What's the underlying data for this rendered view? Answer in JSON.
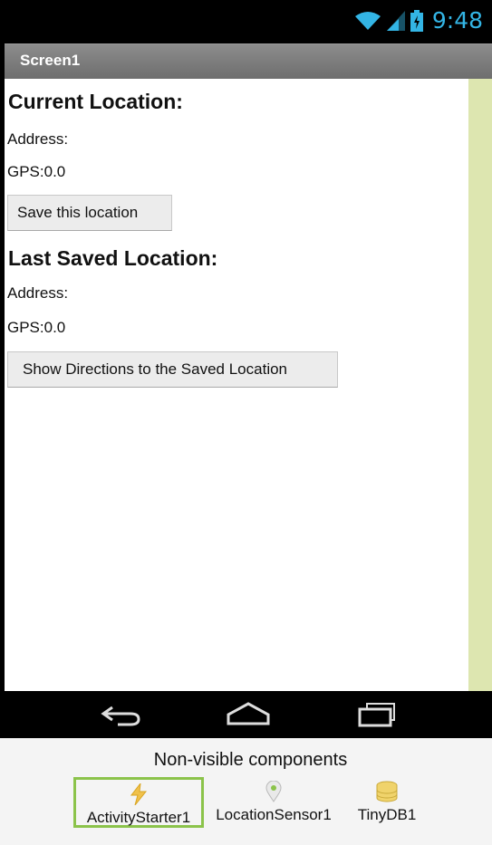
{
  "status_bar": {
    "time": "9:48",
    "icons": [
      "wifi-icon",
      "signal-icon",
      "battery-icon"
    ]
  },
  "title_bar": {
    "title": "Screen1"
  },
  "screen": {
    "current_heading": "Current Location:",
    "current_address": "Address:",
    "current_gps": "GPS:0.0",
    "save_button": "Save this location",
    "last_heading": "Last Saved Location:",
    "last_address": "Address:",
    "last_gps": "GPS:0.0",
    "directions_button": "Show Directions to the Saved Location"
  },
  "nav_bar": {
    "icons": [
      "back-icon",
      "home-icon",
      "recents-icon"
    ]
  },
  "non_visible": {
    "title": "Non-visible components",
    "components": [
      {
        "name": "ActivityStarter1",
        "icon": "lightning-icon",
        "selected": true
      },
      {
        "name": "LocationSensor1",
        "icon": "location-pin-icon",
        "selected": false
      },
      {
        "name": "TinyDB1",
        "icon": "database-icon",
        "selected": false
      }
    ]
  },
  "colors": {
    "accent": "#33b5e5",
    "sidebar": "#dde6b0",
    "selection": "#8bc34a"
  }
}
